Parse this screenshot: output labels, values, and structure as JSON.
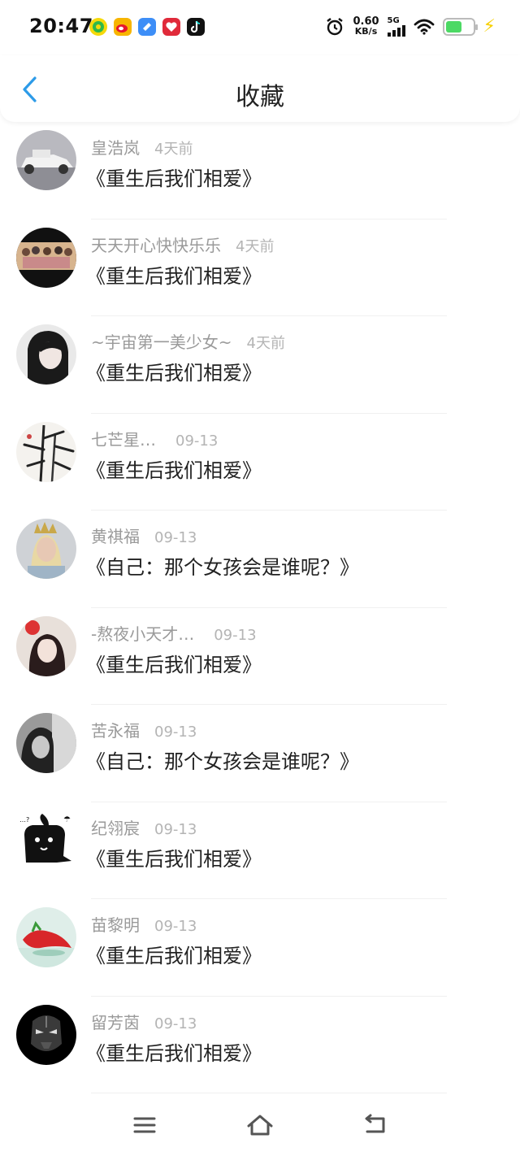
{
  "status_bar": {
    "time": "20:47",
    "net_speed": "0.60",
    "net_speed_unit": "KB/s",
    "network": "5G",
    "battery_level": 0.6,
    "notification_icons": [
      "app-icon-green",
      "weibo-icon",
      "chat-icon",
      "red-app-icon",
      "tiktok-icon"
    ]
  },
  "header": {
    "title": "收藏",
    "back_icon": "chevron-left-icon"
  },
  "items": [
    {
      "name": "皇浩岚",
      "time": "4天前",
      "content": "《重生后我们相爱》"
    },
    {
      "name": "天天开心快快乐乐",
      "time": "4天前",
      "content": "《重生后我们相爱》"
    },
    {
      "name": "~宇宙第一美少女~",
      "time": "4天前",
      "content": "《重生后我们相爱》"
    },
    {
      "name": "七芒星…",
      "time": "09-13",
      "content": "《重生后我们相爱》"
    },
    {
      "name": "黄祺福",
      "time": "09-13",
      "content": "《自己：那个女孩会是谁呢？》"
    },
    {
      "name": "-熬夜小天才…",
      "time": "09-13",
      "content": "《重生后我们相爱》"
    },
    {
      "name": "苦永福",
      "time": "09-13",
      "content": "《自己：那个女孩会是谁呢？》"
    },
    {
      "name": "纪翎宸",
      "time": "09-13",
      "content": "《重生后我们相爱》"
    },
    {
      "name": "苗黎明",
      "time": "09-13",
      "content": "《重生后我们相爱》"
    },
    {
      "name": "留芳茵",
      "time": "09-13",
      "content": "《重生后我们相爱》"
    }
  ],
  "nav_bar": {
    "icons": [
      "menu-icon",
      "home-icon",
      "back-icon"
    ]
  },
  "colors": {
    "accent": "#2d9be8",
    "name": "#9a9a9a",
    "time": "#b4b4b4",
    "text": "#222222"
  }
}
